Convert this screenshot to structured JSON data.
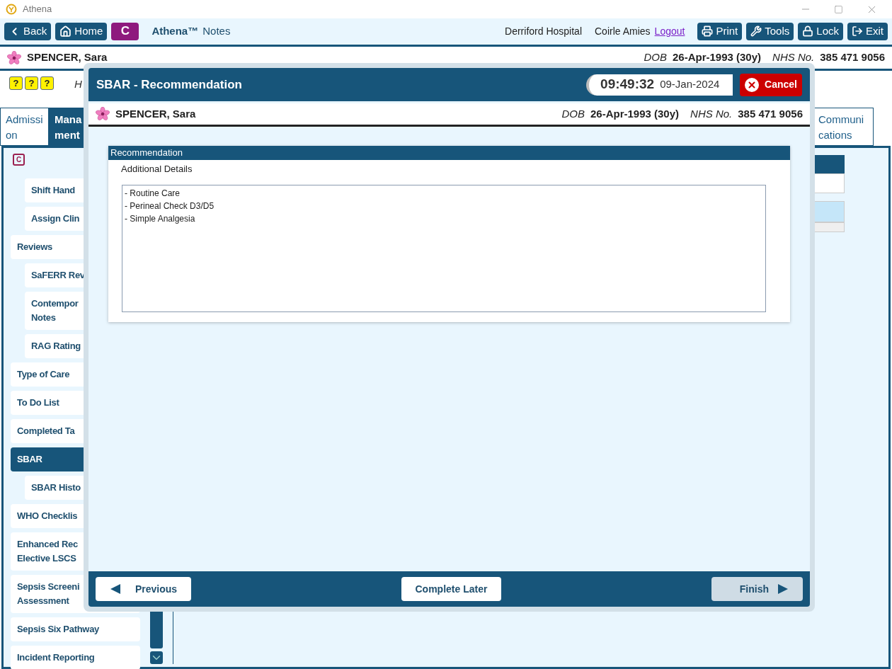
{
  "window": {
    "title": "Athena"
  },
  "toolbar": {
    "nav_buttons": [
      {
        "label": "Back",
        "kind": "back"
      },
      {
        "label": "Home",
        "kind": "home"
      }
    ],
    "c_badge": "C",
    "app_name": "Athena™",
    "app_suffix": "Notes",
    "hospital": "Derriford Hospital",
    "user": "Coirle Amies",
    "logout": "Logout",
    "actions": [
      {
        "label": "Print",
        "kind": "print"
      },
      {
        "label": "Tools",
        "kind": "tools"
      },
      {
        "label": "Lock",
        "kind": "lock"
      },
      {
        "label": "Exit",
        "kind": "exit"
      }
    ]
  },
  "patient": {
    "name": "SPENCER, Sara",
    "dob_label": "DOB",
    "dob": "26-Apr-1993 (30y)",
    "nhs_label": "NHS No.",
    "nhs": "385 471 9056"
  },
  "alert_icons": [
    "?",
    "?",
    "?"
  ],
  "hint_text": "H",
  "tabs": [
    {
      "label": "Admission",
      "selected": false
    },
    {
      "label": "Mana\nment",
      "selected": true
    },
    {
      "label": "Communications",
      "selected": false
    }
  ],
  "sidebar": {
    "badge": "C",
    "continued_children": [
      {
        "label": "Shift Hand",
        "selected": false
      },
      {
        "label": "Assign Clin",
        "selected": false
      }
    ],
    "items": [
      {
        "label": "Reviews",
        "selected": false,
        "children": [
          {
            "label": "SaFERR Rev",
            "selected": false
          },
          {
            "label": "Contempor\nNotes",
            "selected": false
          },
          {
            "label": "RAG Rating",
            "selected": false
          }
        ]
      },
      {
        "label": "Type of Care",
        "selected": false
      },
      {
        "label": "To Do List",
        "selected": false
      },
      {
        "label": "Completed Ta",
        "selected": false
      },
      {
        "label": "SBAR",
        "selected": true,
        "children": [
          {
            "label": "SBAR Histo",
            "selected": false
          }
        ]
      },
      {
        "label": "WHO Checklis",
        "selected": false
      },
      {
        "label": "Enhanced Rec\nElective LSCS",
        "selected": false
      },
      {
        "label": "Sepsis Screeni\nAssessment",
        "selected": false
      },
      {
        "label": "Sepsis Six Pathway",
        "selected": false
      },
      {
        "label": "Incident Reporting",
        "selected": false
      }
    ]
  },
  "modal": {
    "title": "SBAR - Recommendation",
    "time": "09:49:32",
    "date": "09-Jan-2024",
    "cancel": "Cancel",
    "patient": {
      "name": "SPENCER, Sara",
      "dob_label": "DOB",
      "dob": "26-Apr-1993 (30y)",
      "nhs_label": "NHS No.",
      "nhs": "385 471 9056"
    },
    "section_title": "Recommendation",
    "field_label": "Additional Details",
    "field_value": "- Routine Care\n- Perineal Check D3/D5\n- Simple Analgesia",
    "footer": {
      "previous": {
        "label": "Previous",
        "disabled": false
      },
      "complete_later": {
        "label": "Complete Later",
        "disabled": false
      },
      "finish": {
        "label": "Finish",
        "disabled": true
      }
    }
  }
}
